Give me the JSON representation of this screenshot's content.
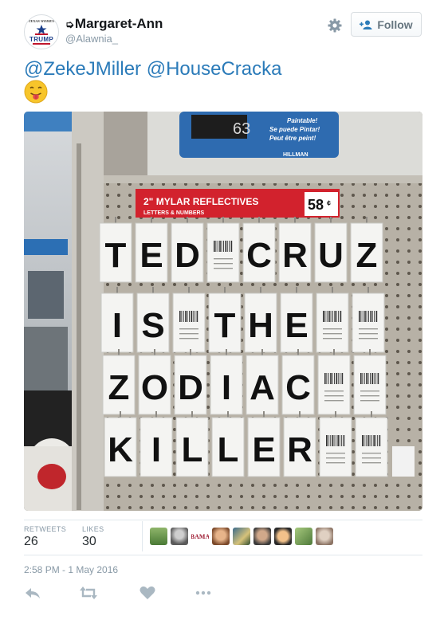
{
  "user": {
    "display_name": "Margaret-Ann",
    "name_prefix_icon": "arrow-pointer-icon",
    "handle": "@Alawnia_",
    "avatar_text_top": "TEXAS WOMEN",
    "avatar_text_main": "TRUMP"
  },
  "header": {
    "follow_label": "Follow",
    "settings_icon": "gear-icon"
  },
  "tweet": {
    "mention_1": "@ZekeJMiller",
    "mention_2": "@HouseCracka",
    "emoji": "face-with-tongue"
  },
  "photo": {
    "sign_title": "2\" MYLAR REFLECTIVES",
    "sign_subtitle": "LETTERS & NUMBERS",
    "price": "58",
    "price_cents": "¢",
    "top_sign_line1": "Paintable!",
    "top_sign_line2": "Se puede Pintar!",
    "top_sign_line3": "Peut être peint!",
    "top_sign_number": "63",
    "brand": "HILLMAN",
    "rows": [
      [
        "T",
        "E",
        "D",
        "",
        "C",
        "R",
        "U",
        "Z"
      ],
      [
        "I",
        "S",
        "",
        "T",
        "H",
        "E",
        "",
        ""
      ],
      [
        "Z",
        "O",
        "D",
        "I",
        "A",
        "C",
        "",
        ""
      ],
      [
        "K",
        "I",
        "L",
        "L",
        "E",
        "R",
        "",
        ""
      ]
    ]
  },
  "stats": {
    "retweets_label": "RETWEETS",
    "retweets_count": "26",
    "likes_label": "LIKES",
    "likes_count": "30",
    "bama_label": "BAMA"
  },
  "timestamp": "2:58 PM - 1 May 2016",
  "colors": {
    "link": "#2b7bb9",
    "muted": "#8899a6",
    "sign_red": "#d2222d"
  }
}
